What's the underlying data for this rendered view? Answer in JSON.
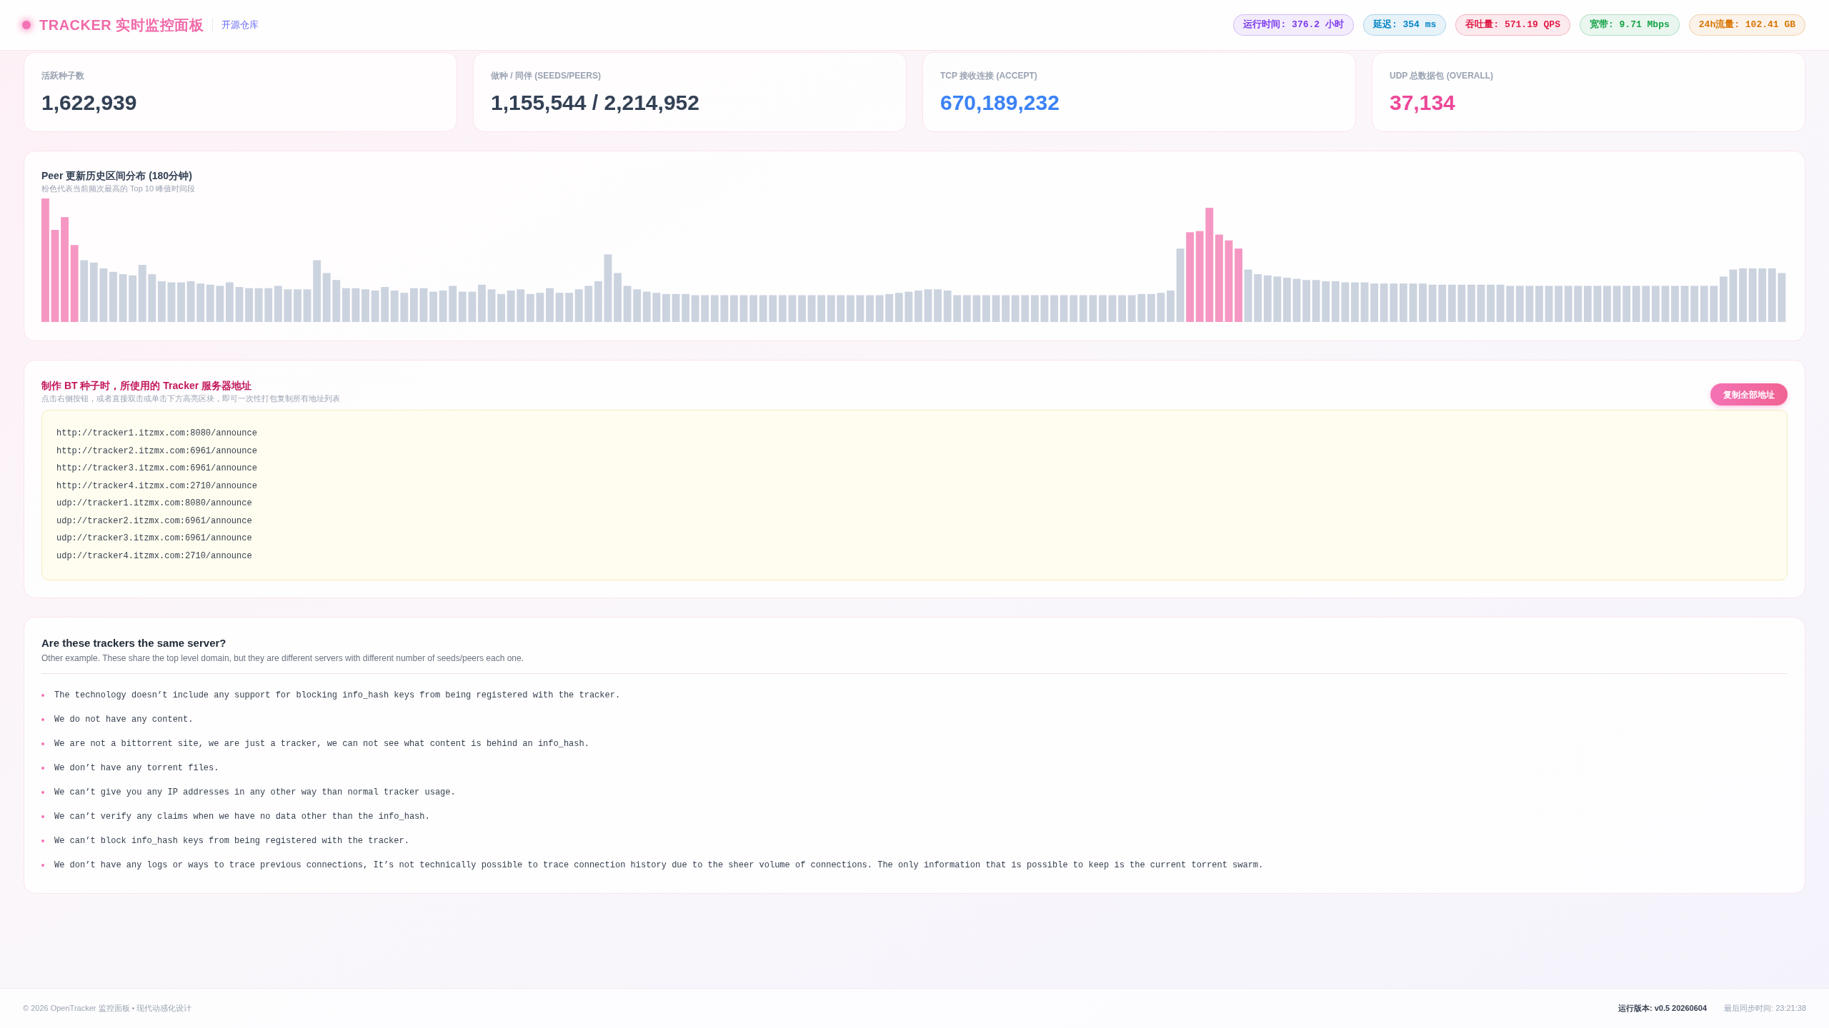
{
  "header": {
    "title": "TRACKER 实时监控面板",
    "repo_link": "开源仓库",
    "badges": [
      {
        "text": "运行时间: 376.2 小时",
        "color": "#7c3aed"
      },
      {
        "text": "延迟: 354 ms",
        "color": "#0284c7"
      },
      {
        "text": "吞吐量: 571.19 QPS",
        "color": "#e11d48"
      },
      {
        "text": "宽带: 9.71 Mbps",
        "color": "#16a34a"
      },
      {
        "text": "24h流量: 102.41 GB",
        "color": "#d97706"
      }
    ]
  },
  "stats": [
    {
      "label": "活跃种子数",
      "value": "1,622,939",
      "color": "#334155"
    },
    {
      "label": "做种 / 同伴 (SEEDS/PEERS)",
      "value": "1,155,544 / 2,214,952",
      "color": "#334155"
    },
    {
      "label": "TCP 接收连接 (ACCEPT)",
      "value": "670,189,232",
      "color": "#3b82f6"
    },
    {
      "label": "UDP 总数据包 (OVERALL)",
      "value": "37,134",
      "color": "#ec4899"
    }
  ],
  "peer_chart": {
    "title": "Peer 更新历史区间分布 (180分钟)",
    "subtitle": "粉色代表当前频次最高的 Top 10 峰值时间段"
  },
  "trackers": {
    "title": "制作 BT 种子时，所使用的 Tracker 服务器地址",
    "subtitle": "点击右侧按钮，或者直接双击或单击下方高亮区块，即可一次性打包复制所有地址列表",
    "copy_button": "复制全部地址",
    "urls": [
      "http://tracker1.itzmx.com:8080/announce",
      "http://tracker2.itzmx.com:6961/announce",
      "http://tracker3.itzmx.com:6961/announce",
      "http://tracker4.itzmx.com:2710/announce",
      "udp://tracker1.itzmx.com:8080/announce",
      "udp://tracker2.itzmx.com:6961/announce",
      "udp://tracker3.itzmx.com:6961/announce",
      "udp://tracker4.itzmx.com:2710/announce"
    ]
  },
  "faq": {
    "title": "Are these trackers the same server?",
    "subtitle": "Other example. These share the top level domain, but they are different servers with different number of seeds/peers each one.",
    "items": [
      "The technology doesn’t include any support for blocking info_hash keys from being registered with the tracker.",
      "We do not have any content.",
      "We are not a bittorrent site, we are just a tracker, we can not see what content is behind an info_hash.",
      "We don’t have any torrent files.",
      "We can’t give you any IP addresses in any other way than normal tracker usage.",
      "We can’t verify any claims when we have no data other than the info_hash.",
      "We can’t block info_hash keys from being registered with the tracker.",
      "We don’t have any logs or ways to trace previous connections, It’s not technically possible to trace connection history due to the sheer volume of connections. The only information that is possible to keep is the current torrent swarm."
    ]
  },
  "footer": {
    "copyright": "© 2026 OpenTracker 监控面板 • 现代动感化设计",
    "version": "运行版本: v0.5 20260604",
    "last_sync": "最后同步时间: 23:21:38"
  }
}
